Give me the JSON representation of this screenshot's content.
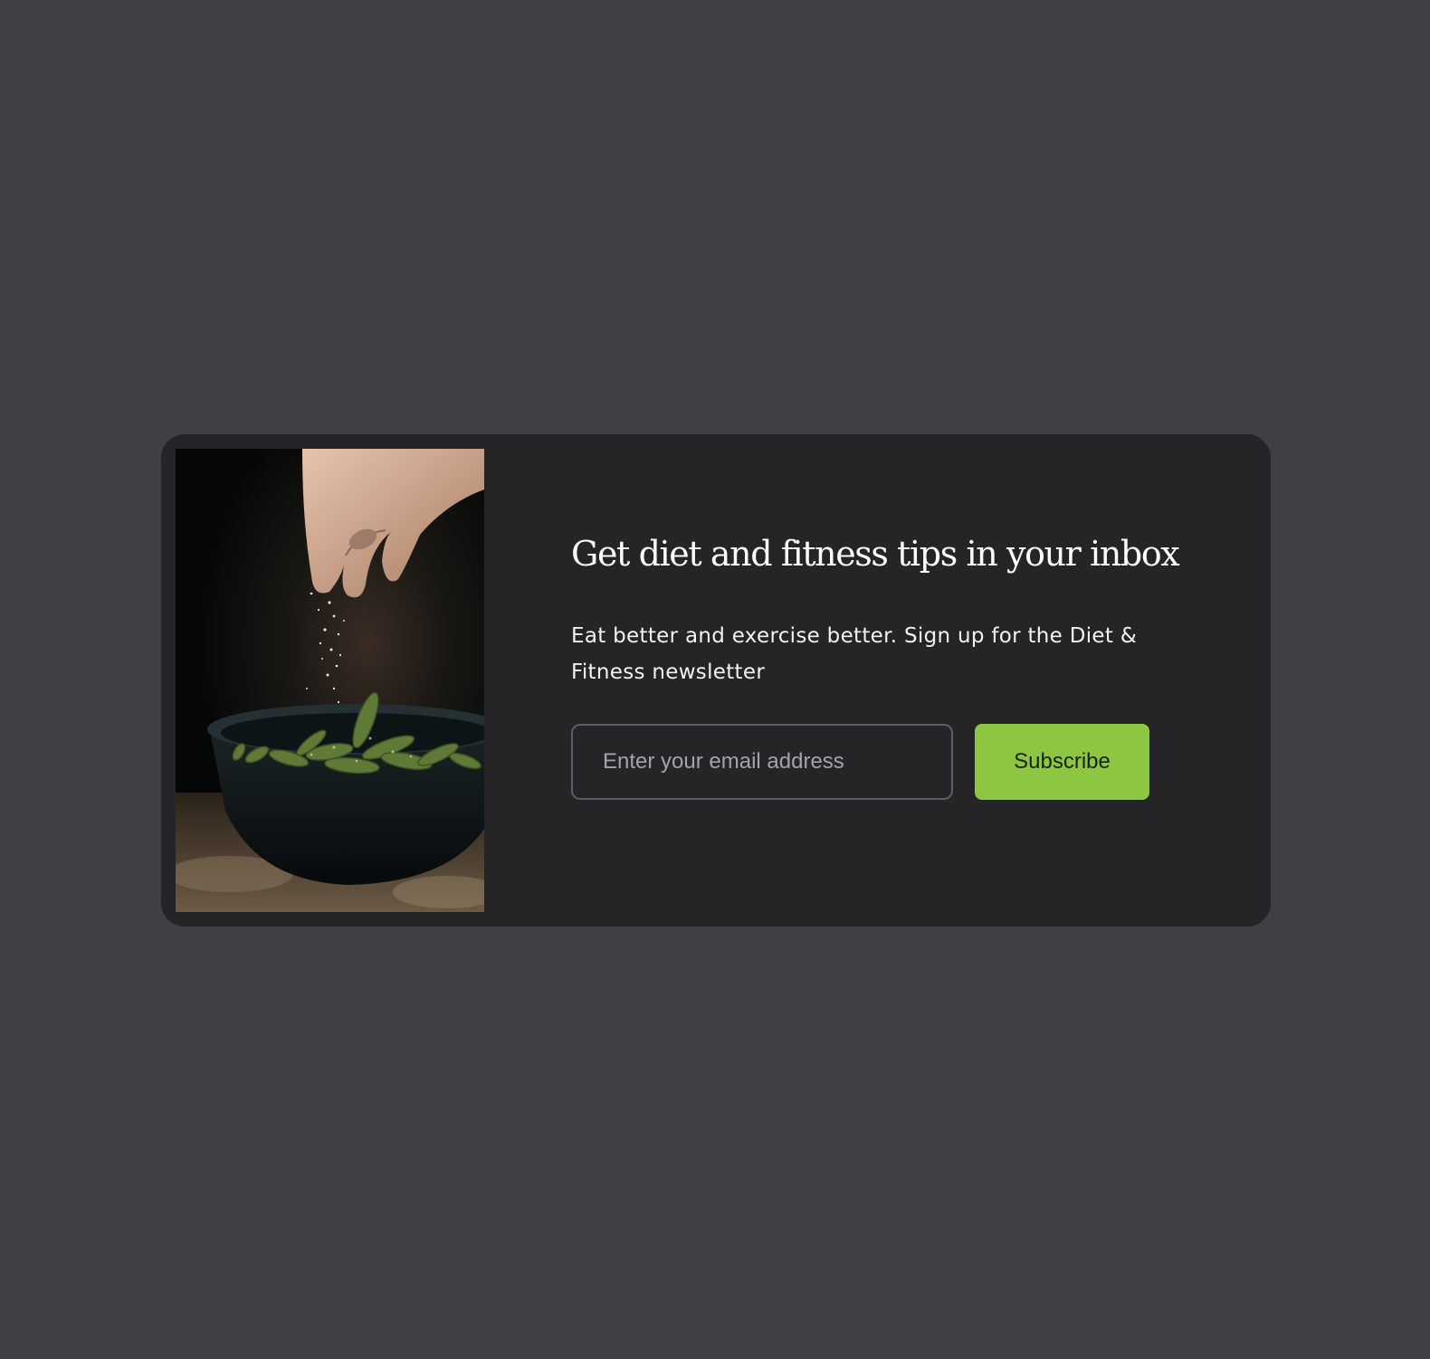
{
  "theme": {
    "page_background": "#3f3f45",
    "card_background": "#252527",
    "accent": "#8dc640",
    "input_border": "#5e5e62"
  },
  "newsletter": {
    "image_alt": "Hand sprinkling salt over a bowl of edamame",
    "title": "Get diet and fitness tips in your inbox",
    "description": "Eat better and exercise better. Sign up for the Diet & Fitness newsletter",
    "email_placeholder": "Enter your email address",
    "email_value": "",
    "subscribe_label": "Subscribe"
  }
}
